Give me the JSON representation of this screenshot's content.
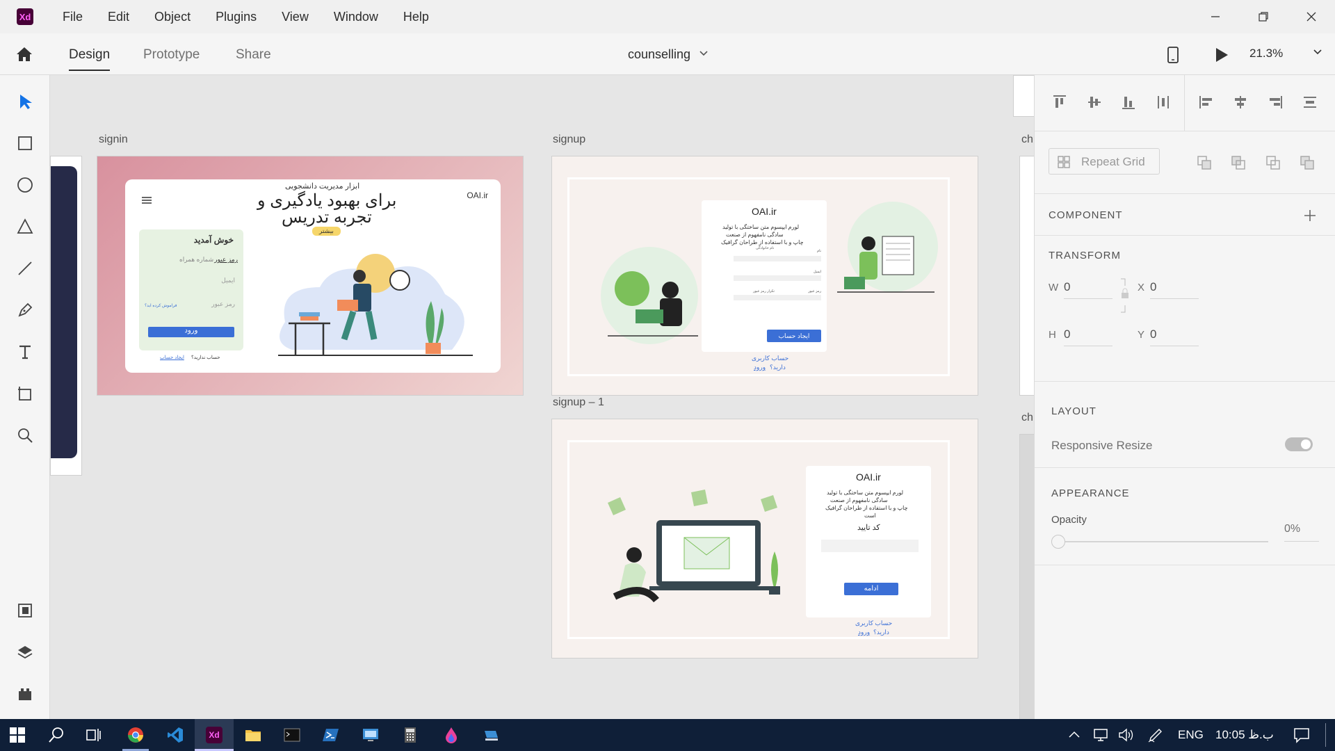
{
  "app": {
    "logo": "Xd"
  },
  "menu": [
    "File",
    "Edit",
    "Object",
    "Plugins",
    "View",
    "Window",
    "Help"
  ],
  "tabs": {
    "design": "Design",
    "prototype": "Prototype",
    "share": "Share"
  },
  "document": {
    "title": "counselling"
  },
  "zoom": "21.3%",
  "artboards": {
    "signin": {
      "label": "signin",
      "brand": "OAI.ir",
      "kicker": "ابزار مدیریت دانشجویی",
      "headline1": "برای بهبود یادگیری و",
      "headline2": "تجربه تدریس",
      "more": "بیشتر",
      "welcome": "خوش آمدید",
      "tab_password": "رمز عبور",
      "tab_phone": "شماره همراه",
      "email": "ایمیل",
      "password": "رمز عبور",
      "forgot": "فراموش کرده اید؟",
      "login": "ورود",
      "no_account": "حساب ندارید؟",
      "create": "ایجاد حساب"
    },
    "signup": {
      "label": "signup",
      "brand": "OAI.ir",
      "desc1": "لورم ایپسوم متن ساختگی با تولید",
      "desc2": "سادگی نامفهوم از صنعت",
      "desc3": "چاپ و با استفاده از طراحان گرافیک",
      "name": "نام",
      "lastname": "نام خانوادگی",
      "email": "ایمیل",
      "password": "رمز عبور",
      "repeat": "تکرار رمز عبور",
      "create": "ایجاد حساب",
      "have1": "حساب کاربری",
      "have2": "دارید؟",
      "login": "ورود"
    },
    "signup1": {
      "label": "signup – 1",
      "brand": "OAI.ir",
      "desc1": "لورم ایپسوم متن ساختگی با تولید",
      "desc2": "سادگی نامفهوم از صنعت",
      "desc3": "چاپ و با استفاده از طراحان گرافیک",
      "desc4": "است",
      "code": "کد تایید",
      "continue": "ادامه",
      "have1": "حساب کاربری",
      "have2": "دارید؟",
      "login": "ورود"
    },
    "partial1": "ch",
    "partial2": "ch"
  },
  "panel": {
    "repeat_grid": "Repeat Grid",
    "component": "COMPONENT",
    "transform": "TRANSFORM",
    "w_label": "W",
    "w_value": "0",
    "x_label": "X",
    "x_value": "0",
    "h_label": "H",
    "h_value": "0",
    "y_label": "Y",
    "y_value": "0",
    "layout": "LAYOUT",
    "responsive": "Responsive Resize",
    "appearance": "APPEARANCE",
    "opacity": "Opacity",
    "opacity_value": "0%"
  },
  "taskbar": {
    "lang": "ENG",
    "time": "10:05 ب.ظ"
  },
  "colors": {
    "accent": "#3b6fd6",
    "xd_bg": "#470137",
    "xd_fg": "#ff61f6",
    "taskbar": "#0f1f38",
    "green": "#7cc05a"
  }
}
